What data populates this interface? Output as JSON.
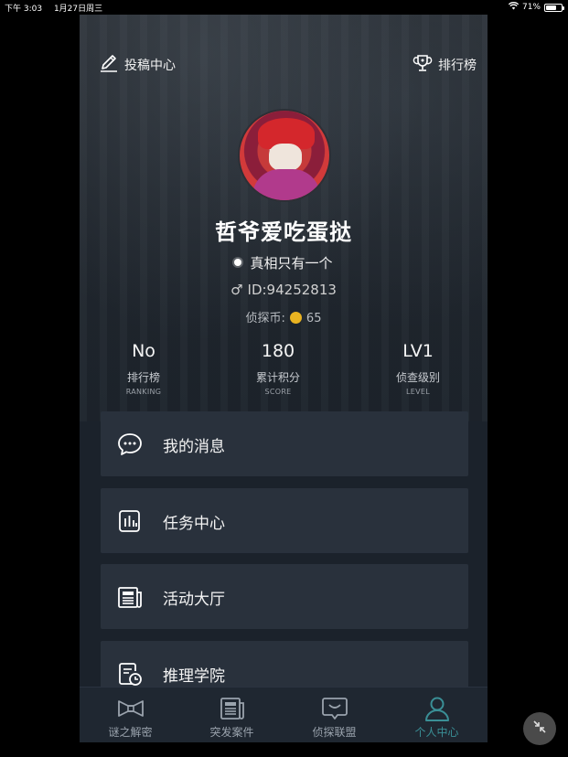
{
  "status_bar": {
    "time": "下午 3:03",
    "date": "1月27日周三",
    "battery": "71%",
    "battery_level": 0.71
  },
  "top_nav": {
    "submit_label": "投稿中心",
    "ranking_label": "排行榜"
  },
  "profile": {
    "nickname": "哲爷爱吃蛋挞",
    "motto": "真相只有一个",
    "gender_symbol": "♂",
    "id_text": "ID:94252813",
    "coins_label": "侦探币:",
    "coins_value": "65"
  },
  "stats": [
    {
      "value": "No",
      "label": "排行榜",
      "sub": "RANKING"
    },
    {
      "value": "180",
      "label": "累计积分",
      "sub": "SCORE"
    },
    {
      "value": "LV1",
      "label": "侦查级别",
      "sub": "LEVEL"
    }
  ],
  "menu": [
    {
      "label": "我的消息",
      "icon": "chat-icon"
    },
    {
      "label": "任务中心",
      "icon": "task-chart-icon"
    },
    {
      "label": "活动大厅",
      "icon": "newspaper-icon"
    },
    {
      "label": "推理学院",
      "icon": "document-clock-icon"
    }
  ],
  "tabs": [
    {
      "label": "谜之解密",
      "icon": "bowtie-icon",
      "active": false
    },
    {
      "label": "突发案件",
      "icon": "newspaper-icon",
      "active": false
    },
    {
      "label": "侦探联盟",
      "icon": "chat-box-icon",
      "active": false
    },
    {
      "label": "个人中心",
      "icon": "person-icon",
      "active": true
    }
  ],
  "colors": {
    "accent": "#3a8f96",
    "card_bg": "#29313c",
    "app_bg": "#1b222b",
    "coin": "#e9b321"
  }
}
